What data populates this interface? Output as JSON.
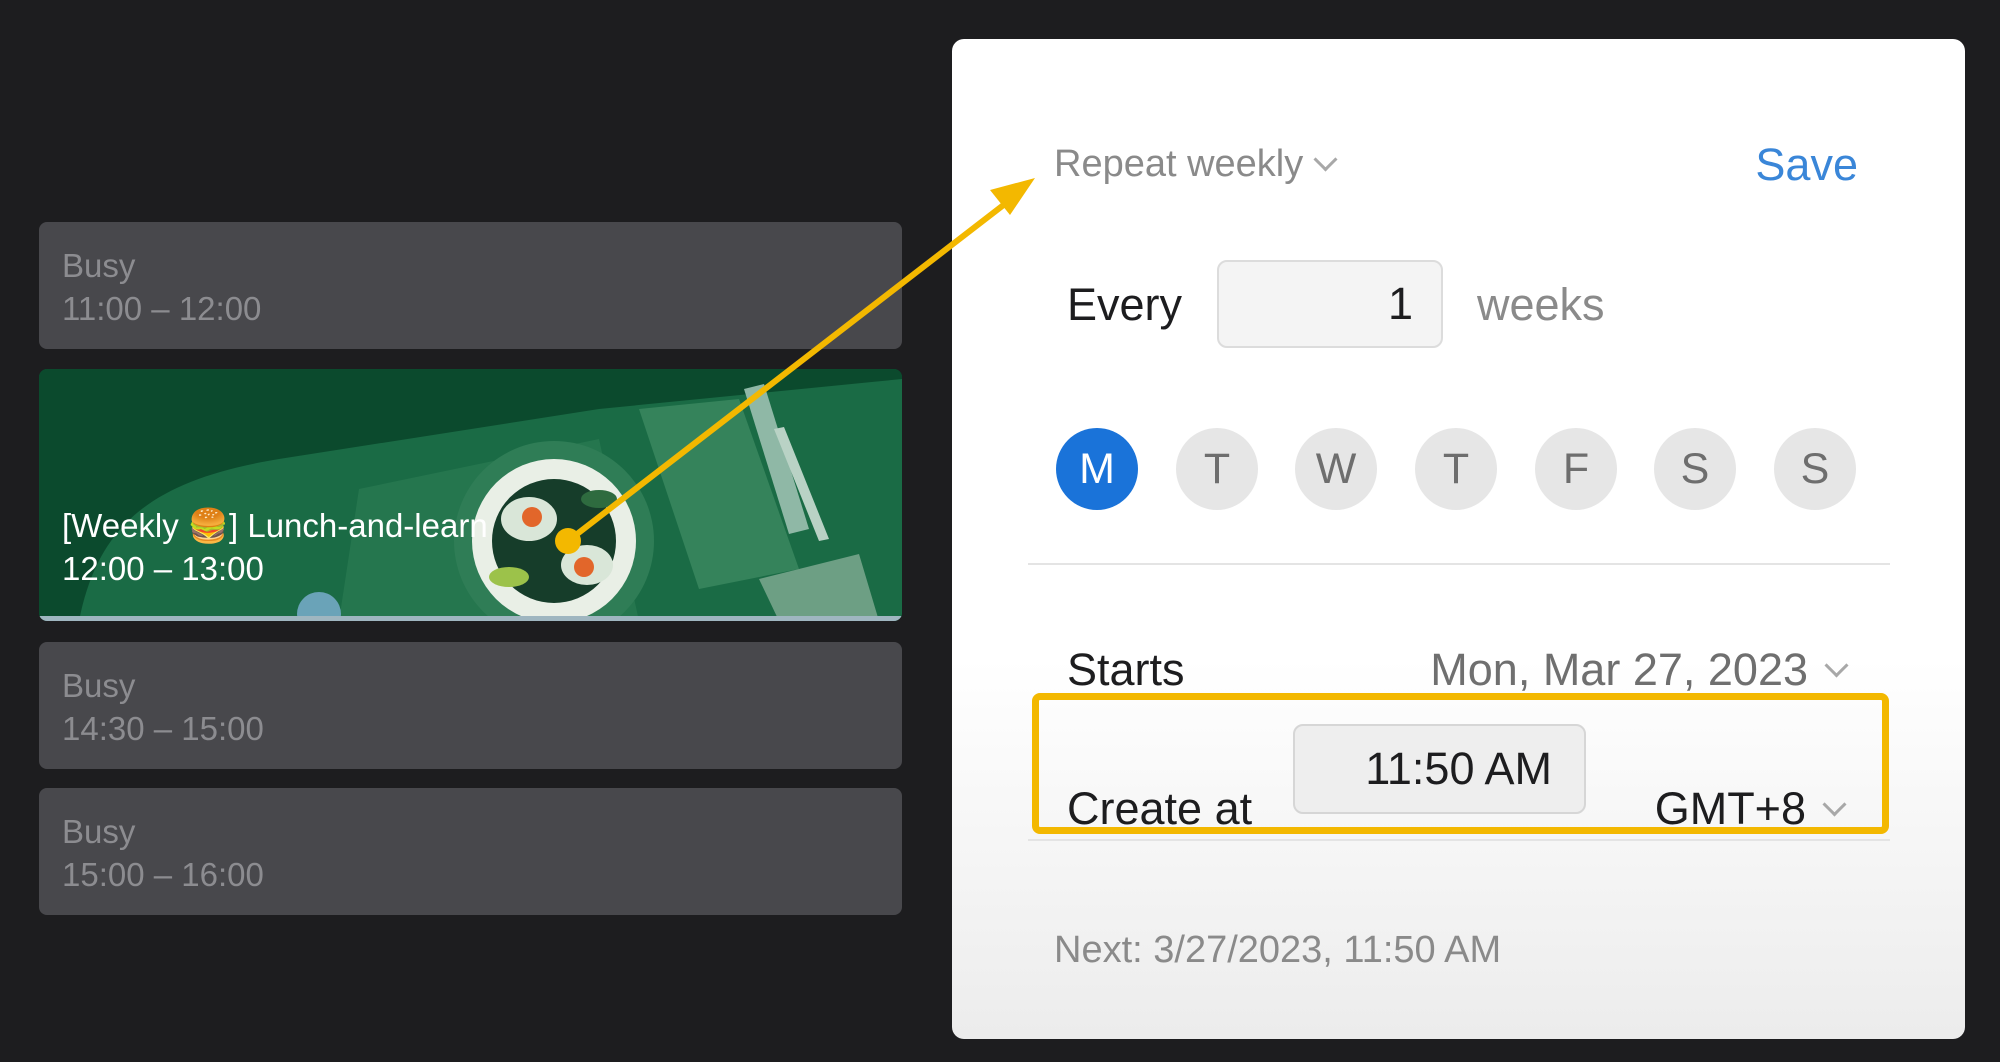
{
  "events": [
    {
      "title": "Busy",
      "time": "11:00 – 12:00"
    },
    {
      "title": "[Weekly 🍔] Lunch-and-learn",
      "time": "12:00 – 13:00"
    },
    {
      "title": "Busy",
      "time": "14:30 – 15:00"
    },
    {
      "title": "Busy",
      "time": "15:00 – 16:00"
    }
  ],
  "repeat_panel": {
    "mode": "Repeat weekly",
    "save_label": "Save",
    "every_label": "Every",
    "interval_value": "1",
    "interval_unit": "weeks",
    "days": [
      {
        "label": "M",
        "selected": true
      },
      {
        "label": "T",
        "selected": false
      },
      {
        "label": "W",
        "selected": false
      },
      {
        "label": "T",
        "selected": false
      },
      {
        "label": "F",
        "selected": false
      },
      {
        "label": "S",
        "selected": false
      },
      {
        "label": "S",
        "selected": false
      }
    ],
    "starts_label": "Starts",
    "start_date": "Mon, Mar 27, 2023",
    "create_at_label": "Create at",
    "create_time": "11:50 AM",
    "timezone": "GMT+8",
    "next_text": "Next: 3/27/2023, 11:50 AM"
  },
  "colors": {
    "accent": "#1a73d9",
    "save_link": "#3a86d8",
    "highlight": "#f3b800",
    "event_busy": "#48484c",
    "event_lunch": "#0d4a2e",
    "background": "#1d1d1f"
  }
}
